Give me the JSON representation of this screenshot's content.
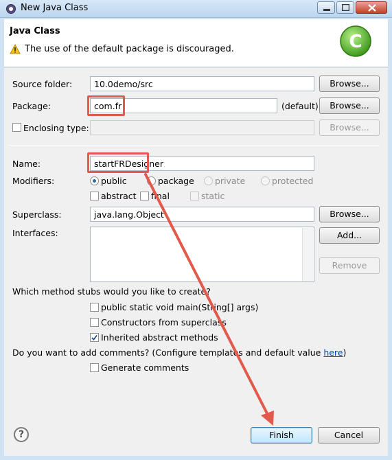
{
  "window": {
    "title": "New Java Class"
  },
  "header": {
    "title": "Java Class",
    "message": "The use of the default package is discouraged."
  },
  "form": {
    "source_folder": {
      "label": "Source folder:",
      "value": "10.0demo/src",
      "browse": "Browse..."
    },
    "package": {
      "label": "Package:",
      "value": "com.fr",
      "hint": "(default)",
      "browse": "Browse..."
    },
    "enclosing_type": {
      "label": "Enclosing type:",
      "value": "",
      "browse": "Browse...",
      "checked": false
    },
    "name": {
      "label": "Name:",
      "value": "startFRDesigner"
    },
    "modifiers": {
      "label": "Modifiers:",
      "access": [
        "public",
        "package",
        "private",
        "protected"
      ],
      "selected": "public",
      "flags": [
        "abstract",
        "final",
        "static"
      ]
    },
    "superclass": {
      "label": "Superclass:",
      "value": "java.lang.Object",
      "browse": "Browse..."
    },
    "interfaces": {
      "label": "Interfaces:",
      "add": "Add...",
      "remove": "Remove"
    },
    "stubs": {
      "question": "Which method stubs would you like to create?",
      "items": [
        {
          "label": "public static void main(String[] args)",
          "checked": false
        },
        {
          "label": "Constructors from superclass",
          "checked": false
        },
        {
          "label": "Inherited abstract methods",
          "checked": true
        }
      ]
    },
    "comments": {
      "question": "Do you want to add comments? (Configure templates and default value ",
      "link": "here",
      "close": ")",
      "generate": {
        "label": "Generate comments",
        "checked": false
      }
    }
  },
  "footer": {
    "help": "?",
    "finish": "Finish",
    "cancel": "Cancel"
  },
  "colors": {
    "highlight": "#e25a4b",
    "arrow": "#e25a4b",
    "link": "#0645ad"
  }
}
